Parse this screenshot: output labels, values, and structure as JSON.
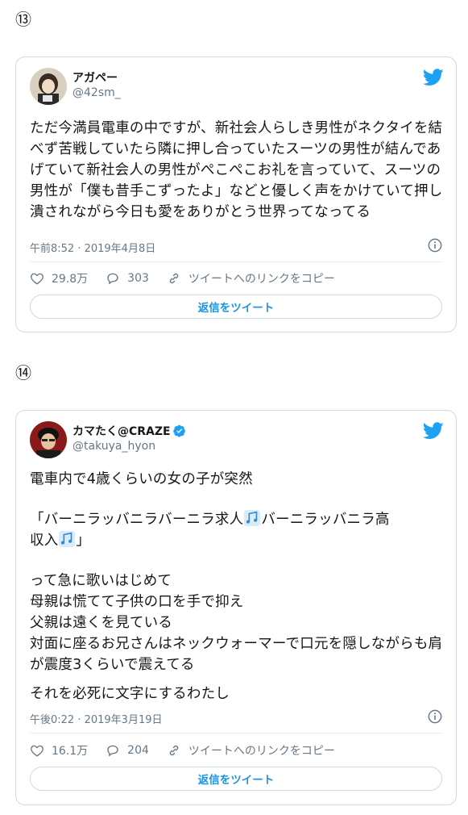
{
  "tweets": [
    {
      "marker": "⑬",
      "name": "アガペー",
      "handle": "@42sm_",
      "text": "ただ今満員電車の中ですが、新社会人らしき男性がネクタイを結べず苦戦していたら隣に押し合っていたスーツの男性が結んであげていて新社会人の男性がぺこぺこお礼を言っていて、スーツの男性が「僕も昔手こずったよ」などと優しく声をかけていて押し潰されながら今日も愛をありがとう世界ってなってる",
      "timestamp": "午前8:52 · 2019年4月8日",
      "likes": "29.8万",
      "replies": "303",
      "copy_link": "ツイートへのリンクをコピー",
      "reply_button": "返信をツイート"
    },
    {
      "marker": "⑭",
      "name": "カマたく@CRAZE",
      "handle": "@takuya_hyon",
      "text_line1": "電車内で4歳くらいの女の子が突然",
      "text_q1": "「バーニラッバニラバーニラ求人",
      "text_q2": "バーニラッバニラ高",
      "text_q3": "収入",
      "text_q4": "」",
      "text_block3": "って急に歌いはじめて\n母親は慌てて子供の口を手で抑え\n父親は遠くを見ている\n対面に座るお兄さんはネックウォーマーで口元を隠しながらも肩が震度3くらいで震えてる",
      "text_last": "それを必死に文字にするわたし",
      "timestamp": "午後0:22 · 2019年3月19日",
      "likes": "16.1万",
      "replies": "204",
      "copy_link": "ツイートへのリンクをコピー",
      "reply_button": "返信をツイート"
    }
  ],
  "colors": {
    "accent": "#1da1f2",
    "muted": "#657786",
    "border": "#cfd9de"
  }
}
